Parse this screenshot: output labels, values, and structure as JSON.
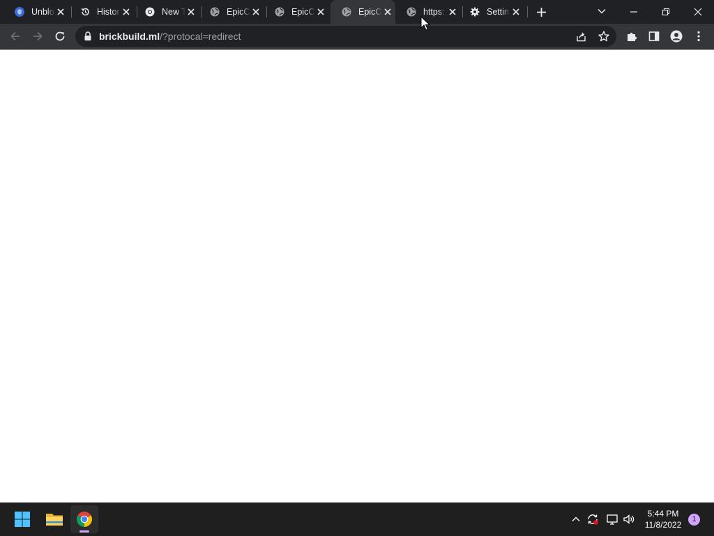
{
  "browser": {
    "tabs": [
      {
        "title": "Unblo",
        "icon": "shield-favicon-icon",
        "active": false
      },
      {
        "title": "Histor",
        "icon": "history-icon",
        "active": false
      },
      {
        "title": "New T",
        "icon": "chrome-icon",
        "active": false
      },
      {
        "title": "EpicC",
        "icon": "globe-icon",
        "active": false
      },
      {
        "title": "EpicC",
        "icon": "globe-icon",
        "active": false
      },
      {
        "title": "EpicC",
        "icon": "globe-icon",
        "active": true
      },
      {
        "title": "https:",
        "icon": "globe-icon",
        "active": false
      },
      {
        "title": "Settin",
        "icon": "gear-icon",
        "active": false
      }
    ],
    "address_bar": {
      "host": "brickbuild.ml",
      "path": "/?protocal=redirect"
    },
    "theme": {
      "frame": "#202124",
      "toolbar": "#35363a",
      "text": "#e8eaed",
      "dim": "#9aa0a6"
    }
  },
  "taskbar": {
    "apps": [
      {
        "name": "Start",
        "icon": "windows-start-icon"
      },
      {
        "name": "File Explorer",
        "icon": "folder-icon"
      },
      {
        "name": "Google Chrome",
        "icon": "chrome-icon",
        "running": true
      }
    ],
    "clock": {
      "time": "5:44 PM",
      "date": "11/8/2022"
    },
    "notification_count": "1",
    "accent": "#d4a5ff"
  }
}
